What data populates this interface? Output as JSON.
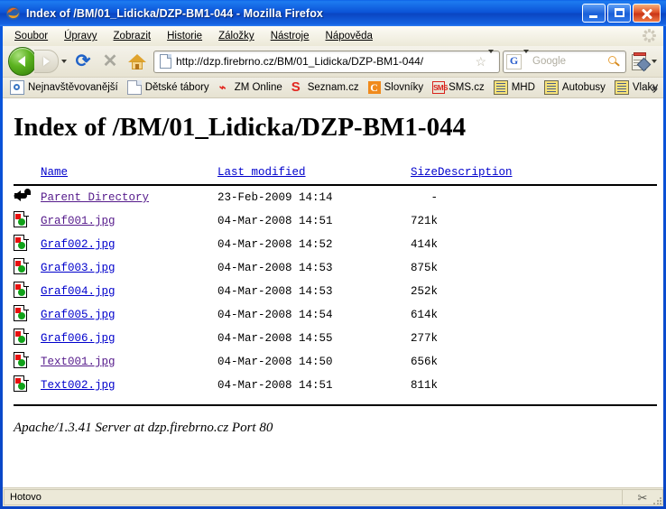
{
  "window": {
    "title": "Index of /BM/01_Lidicka/DZP-BM1-044 - Mozilla Firefox",
    "app_icon": "firefox-icon",
    "buttons": {
      "minimize": "_",
      "maximize": "□",
      "close": "✕"
    },
    "title_color": "#ffffff",
    "titlebar_color": "#0a4fd4"
  },
  "menu": [
    {
      "label": "Soubor"
    },
    {
      "label": "Úpravy"
    },
    {
      "label": "Zobrazit"
    },
    {
      "label": "Historie"
    },
    {
      "label": "Záložky"
    },
    {
      "label": "Nástroje"
    },
    {
      "label": "Nápověda"
    }
  ],
  "toolbar": {
    "back_title": "Zpět",
    "forward_title": "Vpřed",
    "reload_glyph": "⟳",
    "stop_glyph": "✕",
    "home_title": "Domů",
    "url": "http://dzp.firebrno.cz/BM/01_Lidicka/DZP-BM1-044/",
    "star_glyph": "☆",
    "search_engine": "G",
    "search_value": "",
    "search_placeholder": "Google"
  },
  "bookmarks": {
    "items": [
      {
        "label": "Nejnavštěvovanější",
        "icon": "folder-blue-icon"
      },
      {
        "label": "Dětské tábory",
        "icon": "document-icon"
      },
      {
        "label": "ZM Online",
        "icon": "zm-icon"
      },
      {
        "label": "Seznam.cz",
        "icon": "seznam-s-icon"
      },
      {
        "label": "Slovníky",
        "icon": "centrum-c-icon"
      },
      {
        "label": "SMS.cz",
        "icon": "sms-icon"
      },
      {
        "label": "MHD",
        "icon": "book-icon"
      },
      {
        "label": "Autobusy",
        "icon": "book-icon"
      },
      {
        "label": "Vlaky",
        "icon": "book-icon"
      }
    ],
    "overflow": "»"
  },
  "page": {
    "heading": "Index of /BM/01_Lidicka/DZP-BM1-044",
    "columns": {
      "name": "Name",
      "last_modified": "Last modified",
      "size": "Size",
      "description": "Description"
    },
    "rows": [
      {
        "icon": "parent-directory-icon",
        "name": "Parent Directory",
        "modified": "23-Feb-2009 14:14",
        "size": "-",
        "description": "",
        "visited": true
      },
      {
        "icon": "image-file-icon",
        "name": "Graf001.jpg",
        "modified": "04-Mar-2008 14:51",
        "size": "721k",
        "description": "",
        "visited": true
      },
      {
        "icon": "image-file-icon",
        "name": "Graf002.jpg",
        "modified": "04-Mar-2008 14:52",
        "size": "414k",
        "description": "",
        "visited": false
      },
      {
        "icon": "image-file-icon",
        "name": "Graf003.jpg",
        "modified": "04-Mar-2008 14:53",
        "size": "875k",
        "description": "",
        "visited": false
      },
      {
        "icon": "image-file-icon",
        "name": "Graf004.jpg",
        "modified": "04-Mar-2008 14:53",
        "size": "252k",
        "description": "",
        "visited": false
      },
      {
        "icon": "image-file-icon",
        "name": "Graf005.jpg",
        "modified": "04-Mar-2008 14:54",
        "size": "614k",
        "description": "",
        "visited": false
      },
      {
        "icon": "image-file-icon",
        "name": "Graf006.jpg",
        "modified": "04-Mar-2008 14:55",
        "size": "277k",
        "description": "",
        "visited": false
      },
      {
        "icon": "image-file-icon",
        "name": "Text001.jpg",
        "modified": "04-Mar-2008 14:50",
        "size": "656k",
        "description": "",
        "visited": true
      },
      {
        "icon": "image-file-icon",
        "name": "Text002.jpg",
        "modified": "04-Mar-2008 14:51",
        "size": "811k",
        "description": "",
        "visited": false
      }
    ],
    "footer": "Apache/1.3.41 Server at dzp.firebrno.cz Port 80",
    "link_color": "#0000cc",
    "visited_link_color": "#551a8b"
  },
  "statusbar": {
    "text": "Hotovo",
    "right_icon": "scissors-icon"
  }
}
